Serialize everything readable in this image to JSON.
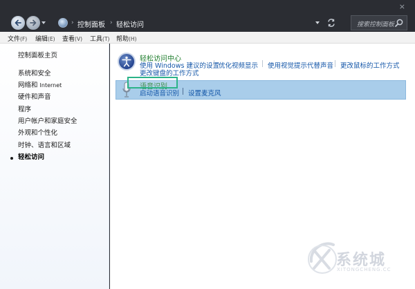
{
  "window": {
    "close_glyph": "×"
  },
  "addressbar": {
    "crumbs": [
      "控制面板",
      "轻松访问"
    ],
    "separator": "›"
  },
  "search": {
    "placeholder": "搜索控制面板"
  },
  "menubar": {
    "items": [
      {
        "label": "文件",
        "key": "(F)"
      },
      {
        "label": "编辑",
        "key": "(E)"
      },
      {
        "label": "查看",
        "key": "(V)"
      },
      {
        "label": "工具",
        "key": "(T)"
      },
      {
        "label": "帮助",
        "key": "(H)"
      }
    ]
  },
  "sidebar": {
    "home": "控制面板主页",
    "items": [
      {
        "label": "系统和安全"
      },
      {
        "label": "网络和 ",
        "latin": "Internet"
      },
      {
        "label": "硬件和声音"
      },
      {
        "label": "程序"
      },
      {
        "label": "用户帐户和家庭安全"
      },
      {
        "label": "外观和个性化"
      },
      {
        "label": "时钟、语言和区域"
      },
      {
        "label": "轻松访问"
      }
    ],
    "active_index": 7
  },
  "category": {
    "title": "轻松访问中心",
    "links": [
      "使用 Windows 建议的设置",
      "优化视频显示",
      "使用视觉提示代替声音",
      "更改鼠标的工作方式",
      "更改键盘的工作方式"
    ]
  },
  "speech": {
    "title": "语音识别",
    "links": [
      "启动语音识别",
      "设置麦克风"
    ]
  },
  "watermark": {
    "text": "系统城",
    "sub": "XITONGCHENG.CC"
  },
  "colors": {
    "title_green": "#1e7d2c",
    "link_blue": "#1356a8",
    "selection_blue": "#a9cdea",
    "highlight_border": "#2bb389"
  },
  "icons": {
    "back": "arrow-left-icon",
    "forward": "arrow-right-icon",
    "refresh": "refresh-icon",
    "search": "search-icon",
    "category": "ease-of-access-icon",
    "speech": "microphone-icon",
    "close": "close-icon"
  }
}
